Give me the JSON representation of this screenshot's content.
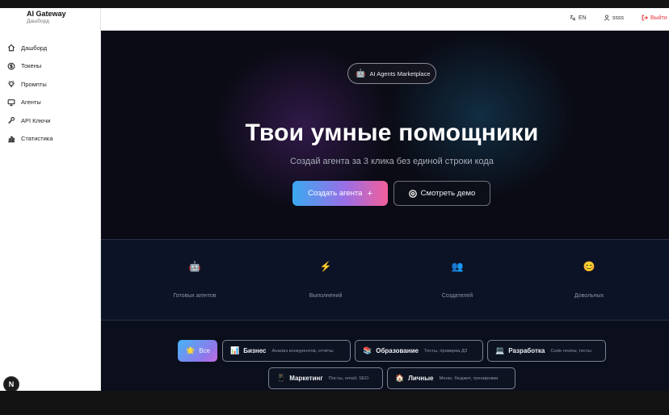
{
  "sidebar": {
    "brand_title": "AI Gateway",
    "brand_subtitle": "Дашборд",
    "items": [
      {
        "label": "Дашборд",
        "icon": "home-icon"
      },
      {
        "label": "Токены",
        "icon": "dollar-icon"
      },
      {
        "label": "Промпты",
        "icon": "lightbulb-icon"
      },
      {
        "label": "Агенты",
        "icon": "monitor-icon"
      },
      {
        "label": "API Ключи",
        "icon": "key-icon"
      },
      {
        "label": "Статистика",
        "icon": "bar-chart-icon"
      }
    ],
    "fab_label": "N"
  },
  "header": {
    "language": "EN",
    "user": "ssss",
    "logout": "Выйти"
  },
  "hero": {
    "badge_icon": "🤖",
    "badge": "AI Agents Marketplace",
    "title": "Твои умные помощники",
    "subtitle": "Создай агента за 3 клика без единой строки кода",
    "primary_button": "Создать агента",
    "primary_button_icon": "+",
    "secondary_button": "Смотреть демо"
  },
  "stats": [
    {
      "icon": "🤖",
      "label": "Готовых агентов"
    },
    {
      "icon": "⚡",
      "label": "Выполнений"
    },
    {
      "icon": "👥",
      "label": "Создателей"
    },
    {
      "icon": "😊",
      "label": "Довольных"
    }
  ],
  "categories": [
    {
      "icon": "🌟",
      "name": "Все",
      "desc": ""
    },
    {
      "icon": "📊",
      "name": "Бизнес",
      "desc": "Анализ конкурентов, отчёты"
    },
    {
      "icon": "📚",
      "name": "Образование",
      "desc": "Тесты, проверка ДЗ"
    },
    {
      "icon": "💻",
      "name": "Разработка",
      "desc": "Code review, тесты"
    },
    {
      "icon": "📱",
      "name": "Маркетинг",
      "desc": "Посты, email, SEO"
    },
    {
      "icon": "🏠",
      "name": "Личные",
      "desc": "Меню, бюджет, тренировки"
    }
  ],
  "colors": {
    "accent_gradient_start": "#3aa9f0",
    "accent_gradient_end": "#f25f9b",
    "logout": "#e5353a",
    "hero_background": "#0a0b14"
  }
}
